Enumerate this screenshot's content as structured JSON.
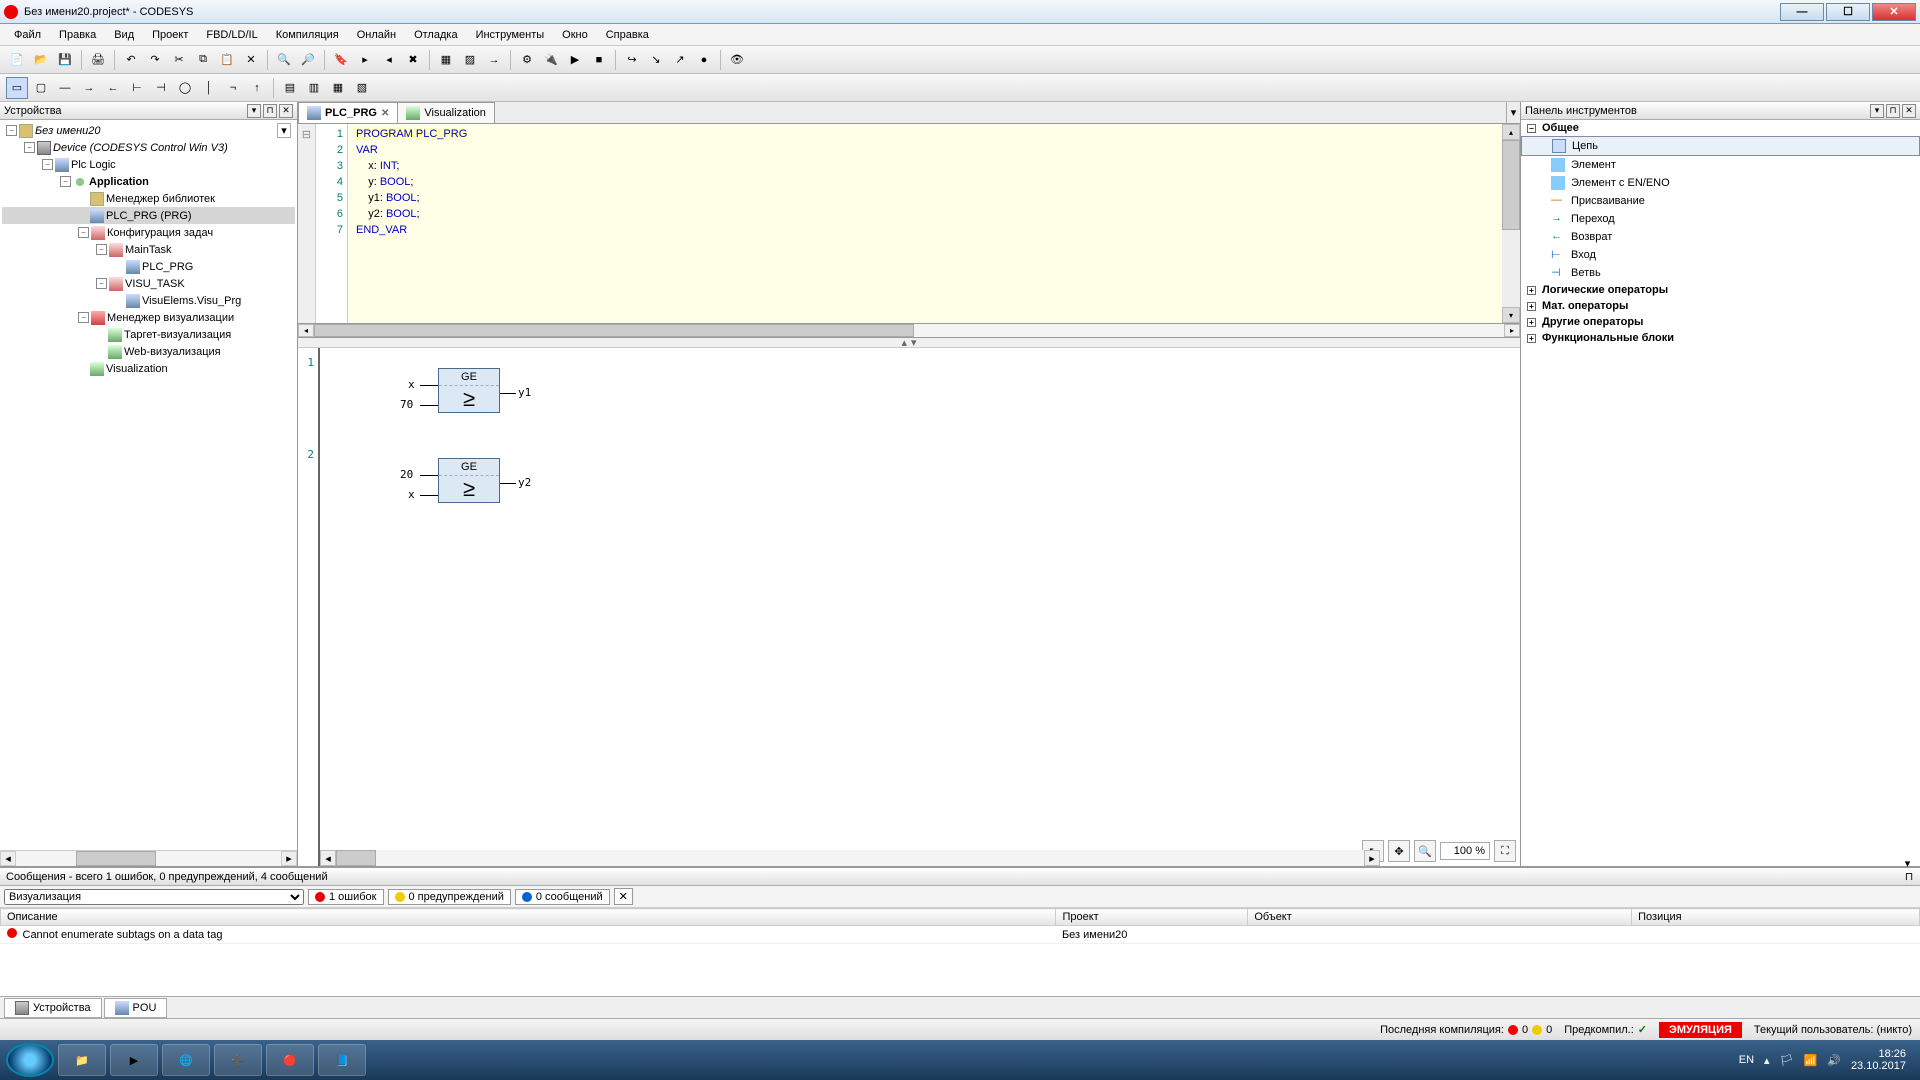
{
  "title": "Без имени20.project* - CODESYS",
  "menubar": [
    "Файл",
    "Правка",
    "Вид",
    "Проект",
    "FBD/LD/IL",
    "Компиляция",
    "Онлайн",
    "Отладка",
    "Инструменты",
    "Окно",
    "Справка"
  ],
  "left": {
    "title": "Устройства",
    "tree": {
      "root": "Без имени20",
      "device": "Device (CODESYS Control Win V3)",
      "plc": "Plc Logic",
      "app": "Application",
      "lib": "Менеджер библиотек",
      "prg": "PLC_PRG (PRG)",
      "taskcfg": "Конфигурация задач",
      "maintask": "MainTask",
      "plcprg": "PLC_PRG",
      "visutask": "VISU_TASK",
      "visuelem": "VisuElems.Visu_Prg",
      "visumgr": "Менеджер визуализации",
      "target": "Таргет-визуализация",
      "web": "Web-визуализация",
      "visualization": "Visualization"
    }
  },
  "tabs": {
    "active": "PLC_PRG",
    "other": "Visualization"
  },
  "code": {
    "l1": "PROGRAM PLC_PRG",
    "l2": "VAR",
    "l3a": "    x: ",
    "l3b": "INT",
    "l3c": ";",
    "l4a": "    y: ",
    "l4b": "BOOL",
    "l4c": ";",
    "l5a": "    y1: ",
    "l5b": "BOOL",
    "l5c": ";",
    "l6a": "    y2: ",
    "l6b": "BOOL",
    "l6c": ";",
    "l7": "END_VAR",
    "ln": [
      "1",
      "2",
      "3",
      "4",
      "5",
      "6",
      "7"
    ]
  },
  "fbd": {
    "net1": "1",
    "net2": "2",
    "b1_name": "GE",
    "b1_sym": "≥",
    "b1_in1": "x",
    "b1_in2": "70",
    "b1_out": "y1",
    "b2_name": "GE",
    "b2_sym": "≥",
    "b2_in1": "20",
    "b2_in2": "x",
    "b2_out": "y2",
    "zoom": "100 %"
  },
  "toolbox": {
    "title": "Панель инструментов",
    "g1": "Общее",
    "items": [
      "Цепь",
      "Элемент",
      "Элемент с EN/ENO",
      "Присваивание",
      "Переход",
      "Возврат",
      "Вход",
      "Ветвь"
    ],
    "g2": "Логические операторы",
    "g3": "Мат. операторы",
    "g4": "Другие операторы",
    "g5": "Функциональные блоки"
  },
  "messages": {
    "summary": "Сообщения - всего 1 ошибок, 0 предупреждений, 4 сообщений",
    "src": "Визуализация",
    "err": "1 ошибок",
    "warn": "0 предупреждений",
    "info": "0 сообщений",
    "cols": [
      "Описание",
      "Проект",
      "Объект",
      "Позиция"
    ],
    "row1_desc": "Cannot enumerate subtags on a data tag",
    "row1_proj": "Без имени20"
  },
  "bottom_tabs": {
    "t1": "Устройства",
    "t2": "POU"
  },
  "status": {
    "compile": "Последняя компиляция:",
    "c_e": "0",
    "c_w": "0",
    "precomp": "Предкомпил.:",
    "emu": "ЭМУЛЯЦИЯ",
    "user": "Текущий пользователь: (никто)"
  },
  "tray": {
    "lang": "EN",
    "time": "18:26",
    "date": "23.10.2017"
  }
}
